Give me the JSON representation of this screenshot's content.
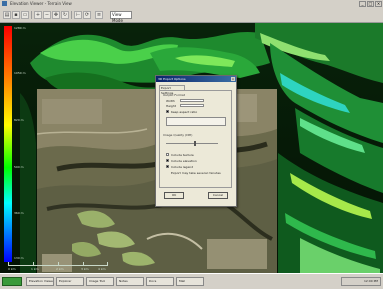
{
  "window": {
    "title": "Elevation Viewer - Terrain View",
    "controls": {
      "minimize": "_",
      "maximize": "□",
      "close": "×"
    }
  },
  "toolbar": {
    "tools": [
      "open-icon",
      "save-icon",
      "print-icon",
      "zoom-in-icon",
      "zoom-out-icon",
      "pan-icon",
      "rotate-icon",
      "measure-icon",
      "refresh-icon"
    ],
    "view_select_value": "View Mode"
  },
  "legend": {
    "colors": [
      "#ff0000",
      "#ff7f00",
      "#ffff00",
      "#00ff00",
      "#00ffff",
      "#0000ff"
    ],
    "tick_labels": [
      "1280 m",
      "1050 m",
      "820 m",
      "590 m",
      "360 m",
      "130 m"
    ]
  },
  "ruler": {
    "tick_labels": [
      "0 km",
      "1 km",
      "2 km",
      "3 km",
      "4 km"
    ]
  },
  "dialog": {
    "title": "3D Export Options",
    "tab_label": "Export Settings",
    "group_output": "Output Format",
    "field_label_width": "Width",
    "field_label_height": "Height",
    "option_keep_aspect": "Keep aspect ratio",
    "group_quality": "Image Quality (DPI)",
    "option_texture": "Include texture",
    "option_elevation": "Include elevation",
    "option_legend": "Include legend",
    "note": "Export may take several minutes",
    "ok_label": "OK",
    "cancel_label": "Cancel"
  },
  "taskbar": {
    "items": [
      "Elevation Viewer",
      "Explorer",
      "Image Tool",
      "Notes",
      "Docs",
      "Mail"
    ],
    "clock": "12:00 PM"
  }
}
